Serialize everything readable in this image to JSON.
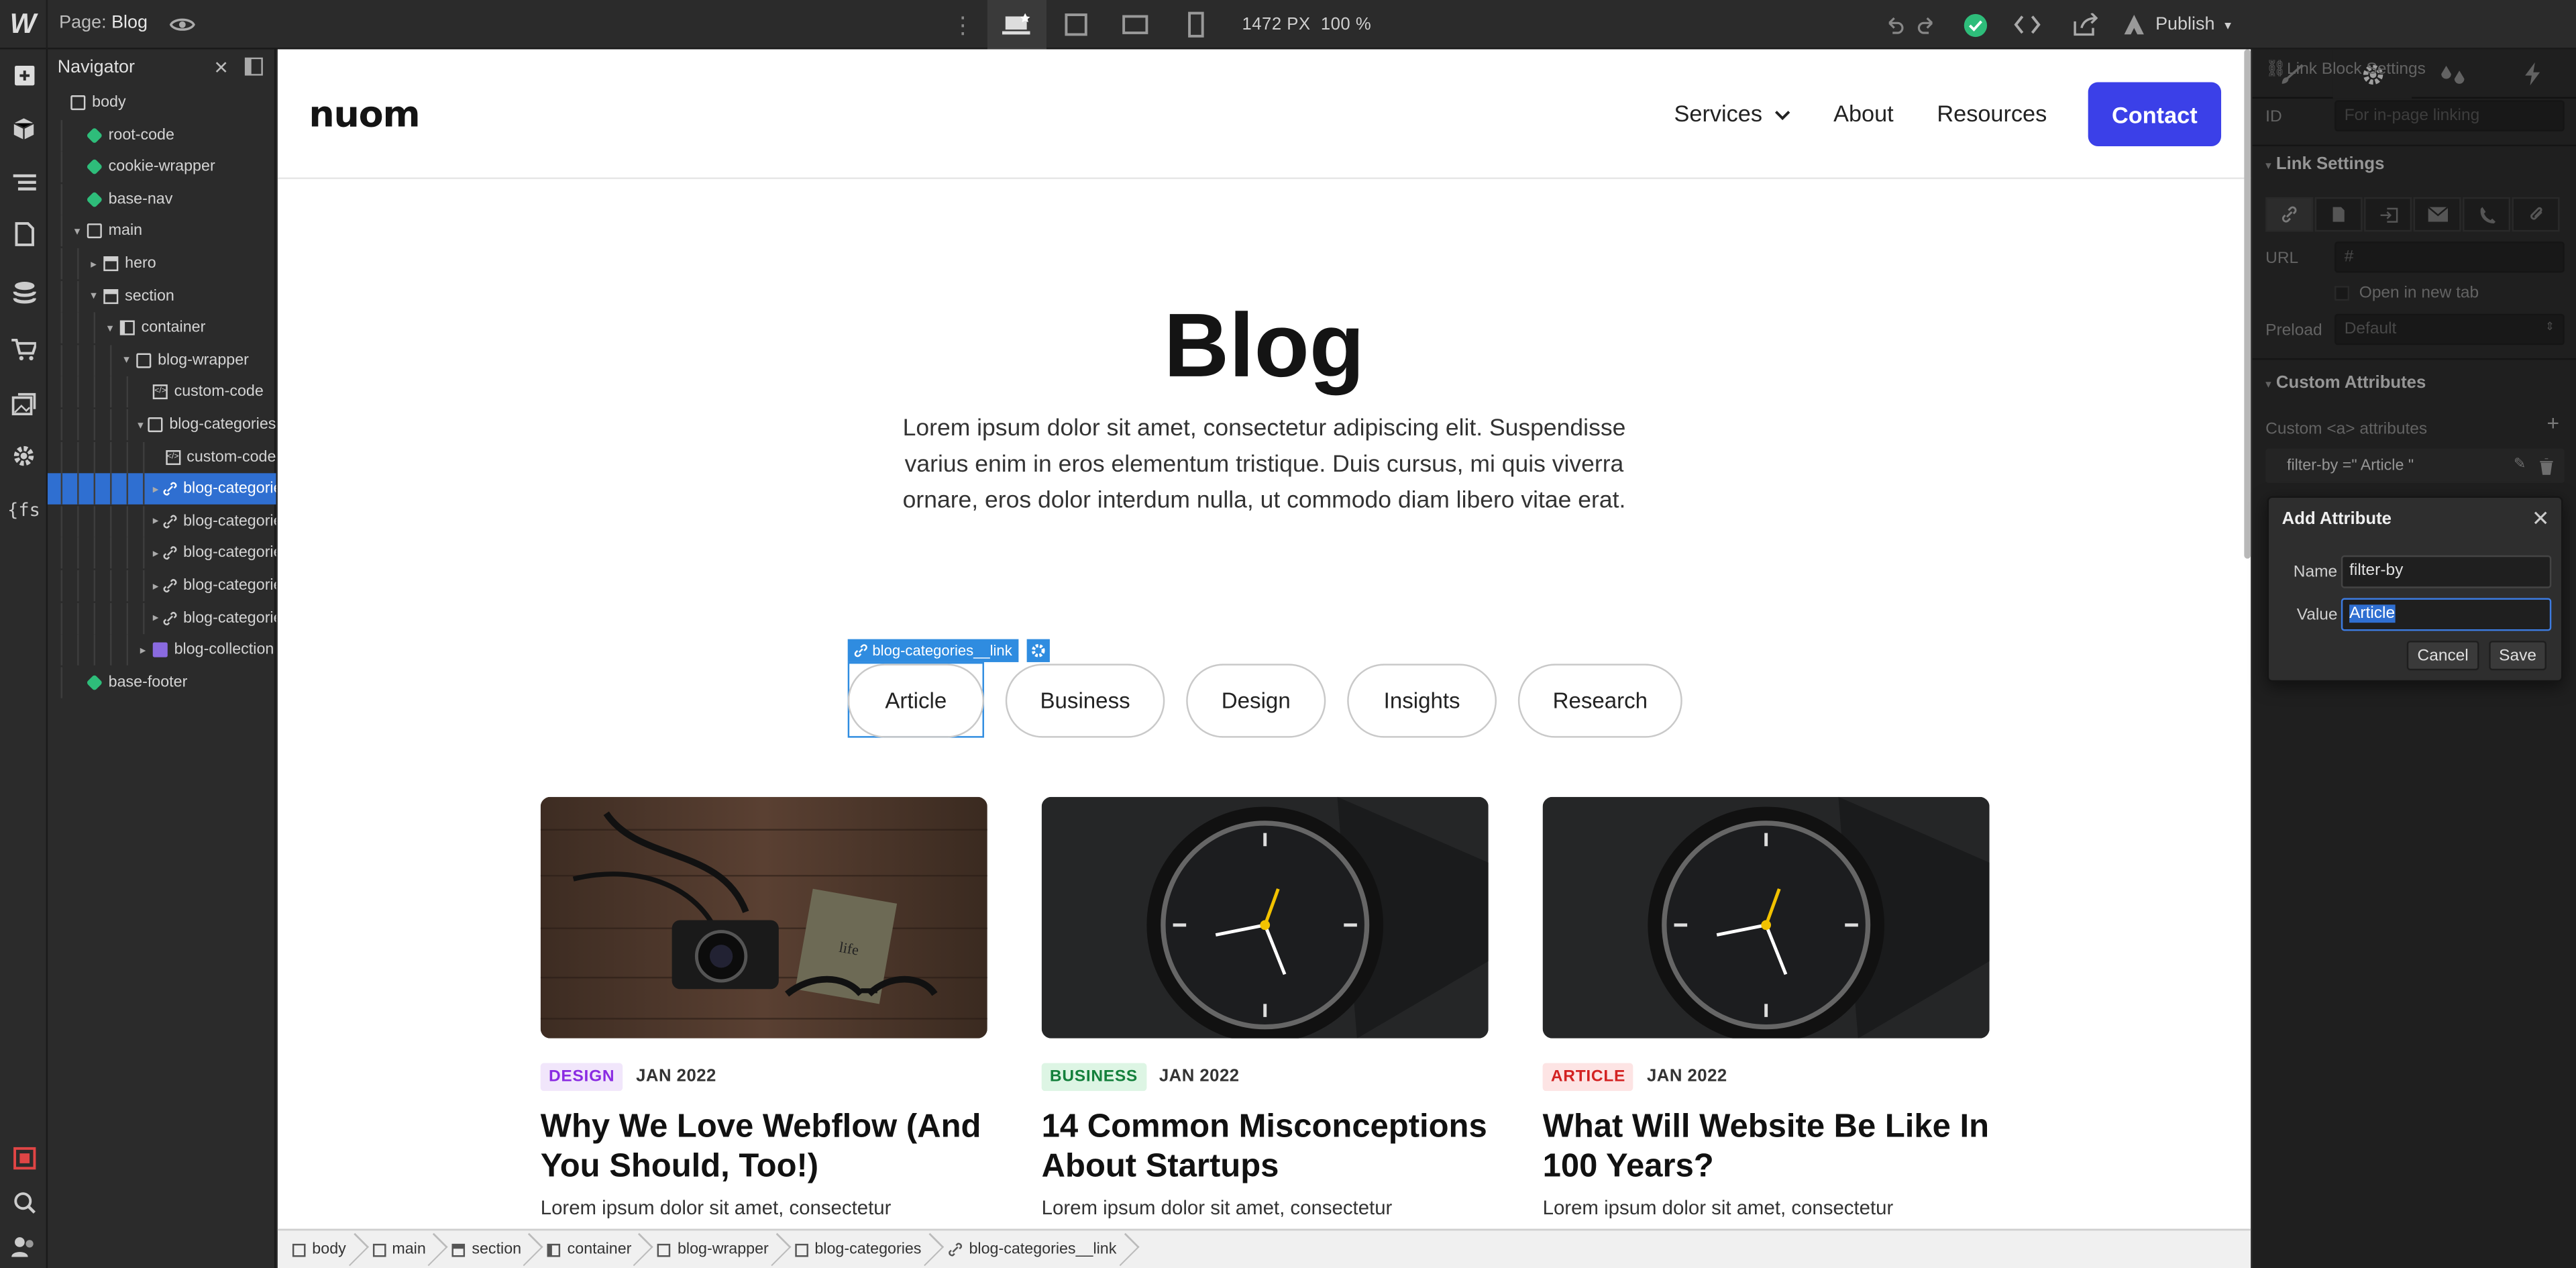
{
  "app": {
    "logo": "W",
    "page_label": "Page:",
    "page_name": "Blog",
    "canvas_width": "1472 PX",
    "zoom": "100 %",
    "publish_label": "Publish"
  },
  "navigator": {
    "title": "Navigator",
    "tree": [
      {
        "label": "body",
        "depth": 0,
        "type": "box",
        "twisty": ""
      },
      {
        "label": "root-code",
        "depth": 1,
        "type": "sym",
        "twisty": ""
      },
      {
        "label": "cookie-wrapper",
        "depth": 1,
        "type": "sym",
        "twisty": ""
      },
      {
        "label": "base-nav",
        "depth": 1,
        "type": "sym",
        "twisty": ""
      },
      {
        "label": "main",
        "depth": 1,
        "type": "box",
        "twisty": "▾"
      },
      {
        "label": "hero",
        "depth": 2,
        "type": "sec",
        "twisty": "▸"
      },
      {
        "label": "section",
        "depth": 2,
        "type": "sec",
        "twisty": "▾"
      },
      {
        "label": "container",
        "depth": 3,
        "type": "con",
        "twisty": "▾"
      },
      {
        "label": "blog-wrapper",
        "depth": 4,
        "type": "box",
        "twisty": "▾"
      },
      {
        "label": "custom-code",
        "depth": 5,
        "type": "code",
        "twisty": ""
      },
      {
        "label": "blog-categories",
        "depth": 5,
        "type": "box",
        "twisty": "▾"
      },
      {
        "label": "custom-code",
        "depth": 6,
        "type": "code",
        "twisty": ""
      },
      {
        "label": "blog-categorie",
        "depth": 6,
        "type": "link",
        "twisty": "▸",
        "selected": true
      },
      {
        "label": "blog-categorie",
        "depth": 6,
        "type": "link",
        "twisty": "▸"
      },
      {
        "label": "blog-categorie",
        "depth": 6,
        "type": "link",
        "twisty": "▸"
      },
      {
        "label": "blog-categorie",
        "depth": 6,
        "type": "link",
        "twisty": "▸"
      },
      {
        "label": "blog-categorie",
        "depth": 6,
        "type": "link",
        "twisty": "▸"
      },
      {
        "label": "blog-collection",
        "depth": 5,
        "type": "coll",
        "twisty": "▸"
      },
      {
        "label": "base-footer",
        "depth": 1,
        "type": "sym",
        "twisty": ""
      }
    ]
  },
  "site": {
    "brand": "nuom",
    "menu": [
      "Services",
      "About",
      "Resources"
    ],
    "contact": "Contact",
    "heading": "Blog",
    "intro": "Lorem ipsum dolor sit amet, consectetur adipiscing elit. Suspendisse varius enim in eros elementum tristique. Duis cursus, mi quis viverra ornare, eros dolor interdum nulla, ut commodo diam libero vitae erat.",
    "selected_label": "blog-categories__link",
    "categories": [
      "Article",
      "Business",
      "Design",
      "Insights",
      "Research"
    ],
    "cards": [
      {
        "tag": "DESIGN",
        "tag_color": "#8a2be2",
        "tag_bg": "#f1e6fb",
        "date": "JAN 2022",
        "title": "Why We Love Webflow (And You Should, Too!)",
        "desc": "Lorem ipsum dolor sit amet, consectetur"
      },
      {
        "tag": "BUSINESS",
        "tag_color": "#14803c",
        "tag_bg": "#ddf5e4",
        "date": "JAN 2022",
        "title": "14 Common Misconceptions About Startups",
        "desc": "Lorem ipsum dolor sit amet, consectetur"
      },
      {
        "tag": "ARTICLE",
        "tag_color": "#d32222",
        "tag_bg": "#fde4e4",
        "date": "JAN 2022",
        "title": "What Will Website Be Like In 100 Years?",
        "desc": "Lorem ipsum dolor sit amet, consectetur"
      }
    ]
  },
  "breadcrumbs": [
    "body",
    "main",
    "section",
    "container",
    "blog-wrapper",
    "blog-categories",
    "blog-categories__link"
  ],
  "panel": {
    "section_title": "Link Block Settings",
    "id_label": "ID",
    "id_placeholder": "For in-page linking",
    "link_settings": "Link Settings",
    "url_label": "URL",
    "url_value": "#",
    "new_tab": "Open in new tab",
    "preload_label": "Preload",
    "preload_value": "Default",
    "custom_attrs": "Custom Attributes",
    "custom_sub": "Custom <a> attributes",
    "attr_row": "filter-by =\" Article \""
  },
  "dialog": {
    "title": "Add Attribute",
    "name_label": "Name",
    "name_value": "filter-by",
    "value_label": "Value",
    "value_value": "Article",
    "cancel": "Cancel",
    "save": "Save"
  },
  "colors": {
    "accent": "#3b40e8",
    "selection": "#2f6fd1"
  }
}
